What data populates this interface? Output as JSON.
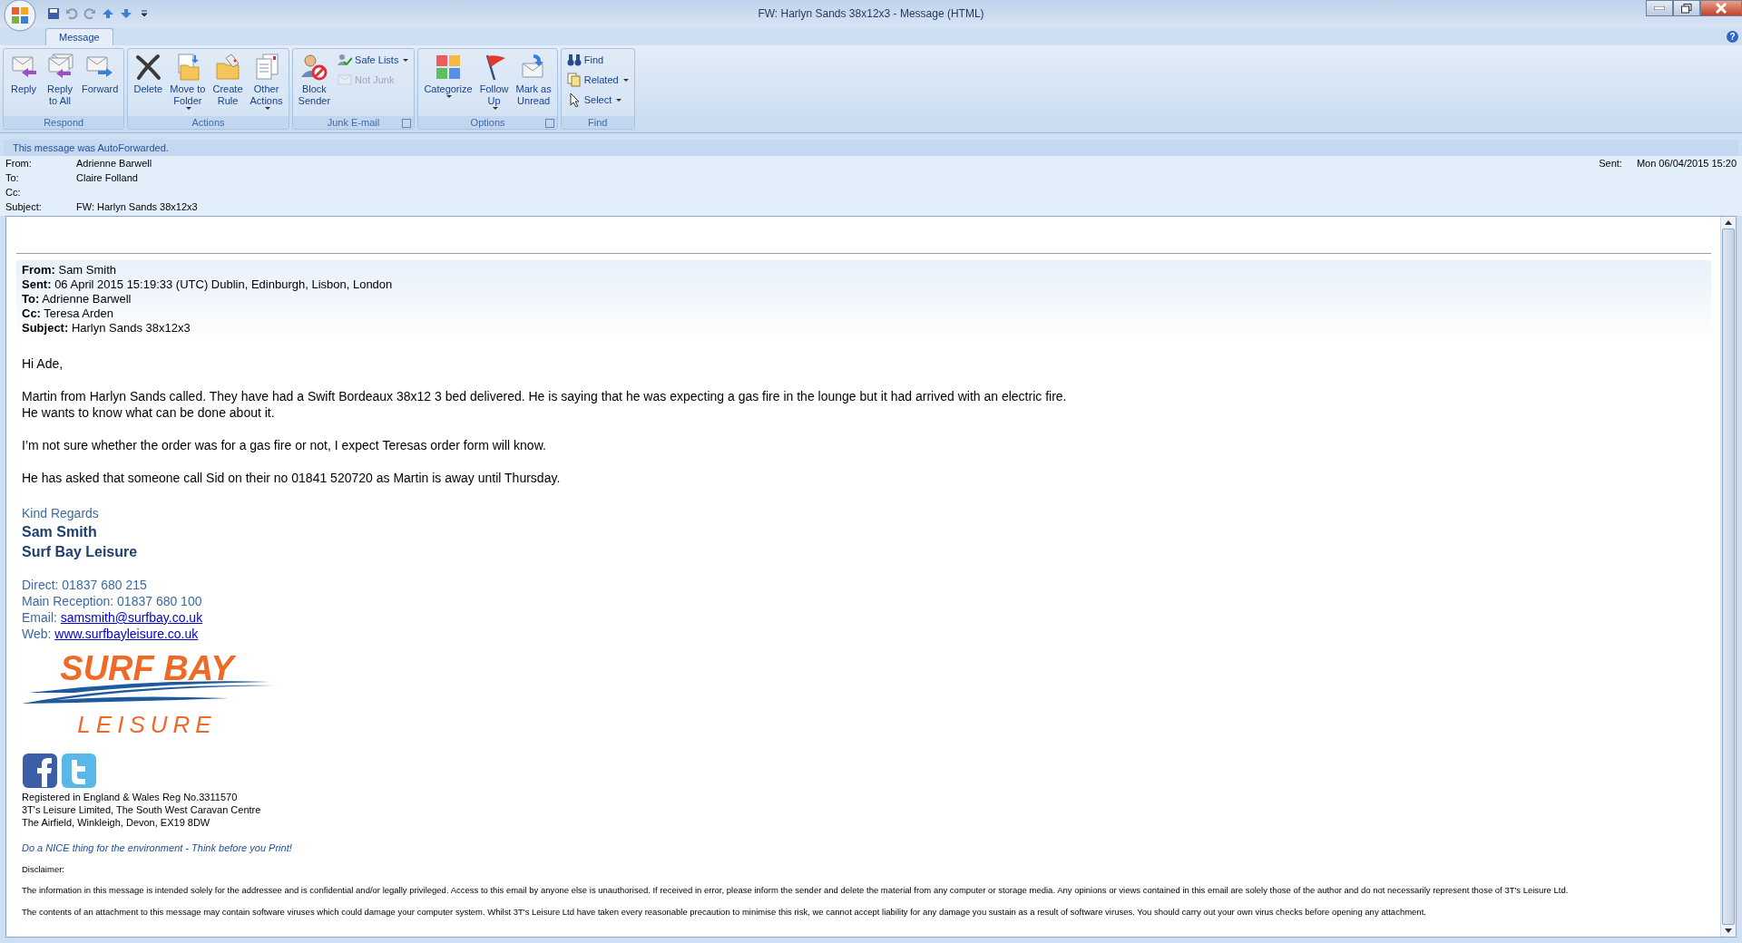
{
  "window": {
    "title": "FW: Harlyn Sands 38x12x3 - Message (HTML)",
    "help": "?"
  },
  "tabs": [
    {
      "label": "Message",
      "selected": true
    }
  ],
  "ribbon": {
    "groups": [
      {
        "label": "Respond",
        "launcher": false,
        "buttons": [
          {
            "kind": "large",
            "lines": [
              "Reply"
            ],
            "dropdown": false,
            "disabled": false
          },
          {
            "kind": "large",
            "lines": [
              "Reply",
              "to All"
            ],
            "dropdown": false,
            "disabled": false
          },
          {
            "kind": "large",
            "lines": [
              "Forward"
            ],
            "dropdown": false,
            "disabled": false
          }
        ]
      },
      {
        "label": "Actions",
        "launcher": false,
        "buttons": [
          {
            "kind": "large",
            "lines": [
              "Delete"
            ],
            "dropdown": false,
            "disabled": false
          },
          {
            "kind": "large",
            "lines": [
              "Move to",
              "Folder"
            ],
            "dropdown": true,
            "disabled": false
          },
          {
            "kind": "large",
            "lines": [
              "Create",
              "Rule"
            ],
            "dropdown": false,
            "disabled": false
          },
          {
            "kind": "large",
            "lines": [
              "Other",
              "Actions"
            ],
            "dropdown": true,
            "disabled": false
          }
        ]
      },
      {
        "label": "Junk E-mail",
        "launcher": true,
        "buttons": [
          {
            "kind": "large",
            "lines": [
              "Block",
              "Sender"
            ],
            "dropdown": false,
            "disabled": false
          },
          {
            "kind": "small",
            "lines": [
              "Safe Lists"
            ],
            "dropdown": true,
            "disabled": false
          },
          {
            "kind": "small",
            "lines": [
              "Not Junk"
            ],
            "dropdown": false,
            "disabled": true
          }
        ]
      },
      {
        "label": "Options",
        "launcher": true,
        "buttons": [
          {
            "kind": "large",
            "lines": [
              "Categorize"
            ],
            "dropdown": true,
            "disabled": false
          },
          {
            "kind": "large",
            "lines": [
              "Follow",
              "Up"
            ],
            "dropdown": true,
            "disabled": false
          },
          {
            "kind": "large",
            "lines": [
              "Mark as",
              "Unread"
            ],
            "dropdown": false,
            "disabled": false
          }
        ]
      },
      {
        "label": "Find",
        "launcher": false,
        "buttons": [
          {
            "kind": "small",
            "lines": [
              "Find"
            ],
            "dropdown": false,
            "disabled": false
          },
          {
            "kind": "small",
            "lines": [
              "Related"
            ],
            "dropdown": true,
            "disabled": false
          },
          {
            "kind": "small",
            "lines": [
              "Select"
            ],
            "dropdown": true,
            "disabled": false
          }
        ]
      }
    ]
  },
  "info_bar": "This message was AutoForwarded.",
  "header": {
    "fields": [
      {
        "label": "From:",
        "value": "Adrienne Barwell"
      },
      {
        "label": "To:",
        "value": "Claire Folland"
      },
      {
        "label": "Cc:"
      },
      {
        "label": "Subject:",
        "value": "FW: Harlyn Sands 38x12x3"
      }
    ],
    "sent_label": "Sent:",
    "sent_value": "Mon 06/04/2015 15:20"
  },
  "body": {
    "forwarded_header": [
      {
        "label": "From:",
        "value": "Sam Smith"
      },
      {
        "label": "Sent:",
        "value": "06 April 2015 15:19:33 (UTC) Dublin, Edinburgh, Lisbon, London"
      },
      {
        "label": "To:",
        "value": "Adrienne Barwell"
      },
      {
        "label": "Cc:",
        "value": "Teresa Arden"
      },
      {
        "label": "Subject:",
        "value": "Harlyn Sands 38x12x3"
      }
    ],
    "greeting": "Hi Ade,",
    "paragraphs": [
      {
        "lines": [
          "Martin from Harlyn Sands called. They have had a Swift Bordeaux 38x12 3 bed delivered. He is saying that he was expecting a gas fire in the lounge but it had arrived with an electric fire.",
          "He wants to know what can be done about it."
        ]
      },
      {
        "lines": [
          "I’m not sure whether the order was for a gas fire or not, I expect Teresas order form will know."
        ]
      },
      {
        "lines": [
          "He has asked that someone call Sid on their no 01841 520720 as Martin is away until Thursday."
        ]
      }
    ],
    "signature": {
      "closing": "Kind Regards",
      "name": "Sam Smith",
      "company": "Surf Bay Leisure",
      "contacts": [
        {
          "label": "Direct:  01837 680 215"
        },
        {
          "label": "Main Reception:  01837 680 100"
        },
        {
          "label": "Email: ",
          "link": "samsmith@surfbay.co.uk"
        },
        {
          "label": "Web: ",
          "link": "www.surfbayleisure.co.uk"
        }
      ],
      "logo_top": "SURF BAY",
      "logo_bottom": "LEISURE",
      "legal": [
        "Registered in England & Wales Reg No.3311570",
        "3T's Leisure Limited, The South West Caravan Centre",
        "The Airfield, Winkleigh, Devon, EX19 8DW"
      ],
      "environment_note": "Do a NICE thing for the environment - Think before you Print!",
      "disclaimer_title": "Disclaimer:",
      "disclaimer": [
        "The information in this message is intended solely for the addressee and is confidential and/or legally privileged. Access to this email by anyone else is unauthorised. If received in error, please inform the sender and delete the material from any computer or storage media. Any opinions or views contained in this email are solely those of the author and do not necessarily represent those of 3T's Leisure Ltd.",
        "The contents of an attachment to this message may contain software viruses which could damage your computer system. Whilst 3T's Leisure Ltd have taken every reasonable precaution to minimise this risk, we cannot accept liability for any damage you sustain as a result of software viruses. You should carry out your own virus checks before opening any attachment."
      ]
    }
  }
}
